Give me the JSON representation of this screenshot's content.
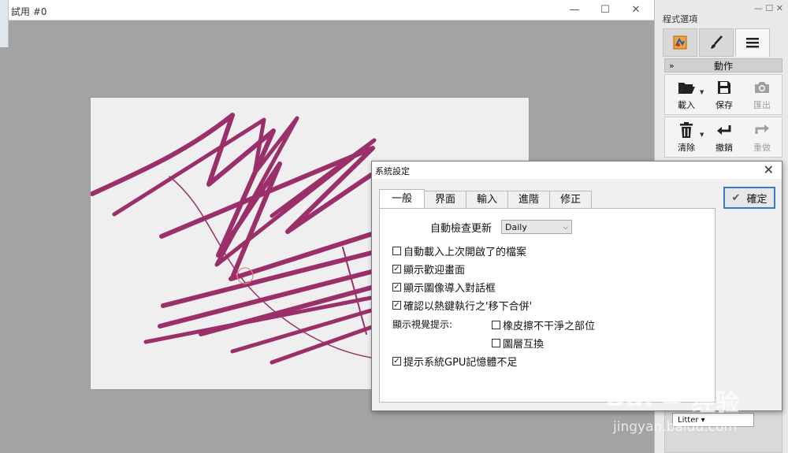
{
  "main_window": {
    "title": "試用 #0",
    "controls": {
      "minimize": "—",
      "maximize": "☐",
      "close": "✕"
    }
  },
  "right_panel": {
    "title": "程式選項",
    "tabs": [
      {
        "icon": "canvas-settings-icon"
      },
      {
        "icon": "brush-icon"
      },
      {
        "icon": "menu-icon"
      }
    ],
    "active_tab": 2,
    "section_title": "動作",
    "buttons_row1": [
      {
        "label": "載入",
        "icon": "folder-open-icon",
        "enabled": true
      },
      {
        "label": "保存",
        "icon": "save-icon",
        "enabled": true
      },
      {
        "label": "匯出",
        "icon": "camera-icon",
        "enabled": false
      }
    ],
    "buttons_row2": [
      {
        "label": "清除",
        "icon": "trash-icon",
        "enabled": true
      },
      {
        "label": "撤銷",
        "icon": "undo-icon",
        "enabled": true
      },
      {
        "label": "重做",
        "icon": "redo-icon",
        "enabled": false
      }
    ],
    "lower_dropdown": "Litter"
  },
  "dialog": {
    "title": "系統設定",
    "close": "✕",
    "tabs": [
      "一般",
      "界面",
      "輸入",
      "進階",
      "修正"
    ],
    "active_tab": 0,
    "auto_update_label": "自動檢查更新",
    "auto_update_value": "Daily",
    "options": [
      {
        "label": "自動載入上次開啟了的檔案",
        "checked": false
      },
      {
        "label": "顯示歡迎畫面",
        "checked": true
      },
      {
        "label": "顯示圖像導入對話框",
        "checked": true
      },
      {
        "label": "確認以熱鍵執行之'移下合併'",
        "checked": true
      }
    ],
    "visual_hints_label": "顯示視覺提示:",
    "visual_hints": [
      {
        "label": "橡皮擦不干淨之部位",
        "checked": false
      },
      {
        "label": "圖層互換",
        "checked": false
      }
    ],
    "gpu_option": {
      "label": "提示系統GPU記憶體不足",
      "checked": true
    },
    "ok_label": "確定"
  },
  "watermark": {
    "brand_left": "Bai",
    "brand_right": "经验",
    "url": "jingyan.baidu.com"
  },
  "colors": {
    "stroke": "#9b2f6a",
    "accent": "#3b79c8"
  }
}
